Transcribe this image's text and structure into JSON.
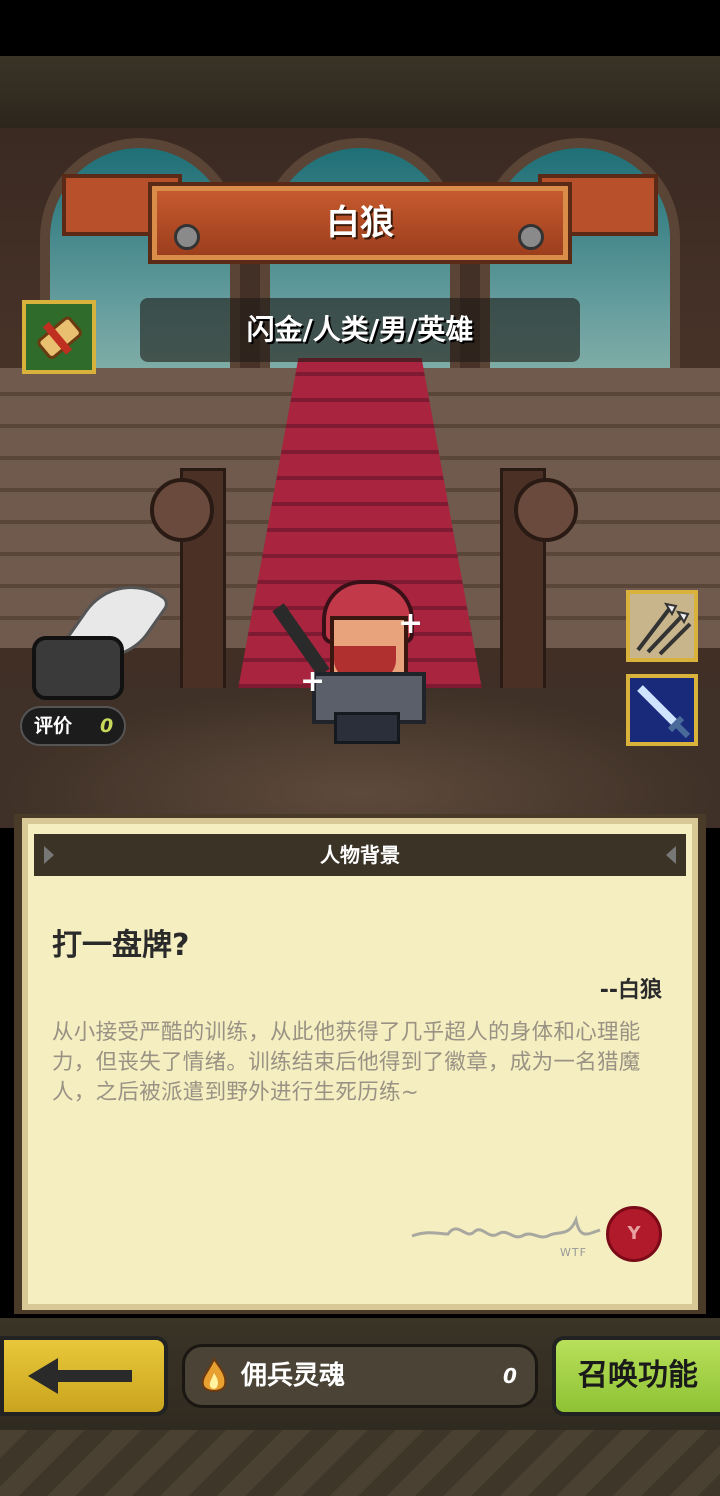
{
  "hero": {
    "name": "白狼",
    "subtitle": "闪金/人类/男/英雄"
  },
  "rating": {
    "label": "评价",
    "value": "0"
  },
  "panel": {
    "title": "人物背景",
    "quote": "打一盘牌?",
    "quote_author": "--白狼",
    "backstory": "从小接受严酷的训练，从此他获得了几乎超人的身体和心理能力，但丧失了情绪。训练结束后他得到了徽章，成为一名猎魔人，之后被派遣到野外进行生死历练~",
    "signature_mark": "WTF"
  },
  "bottom": {
    "soul_label": "佣兵灵魂",
    "soul_count": "0",
    "summon_label": "召唤功能"
  },
  "icons": {
    "scroll": "scroll-icon",
    "inkwell": "inkwell-quill-icon",
    "skill1": "triple-arrow-skill-icon",
    "skill2": "sword-skill-icon",
    "soul": "flame-soul-icon",
    "back": "back-arrow-icon",
    "seal": "wax-seal-icon"
  },
  "colors": {
    "banner": "#b8502b",
    "parchment": "#f4eec0",
    "back_button": "#e8c83a",
    "summon_button": "#a6d24a",
    "skill_border": "#d8b23a"
  }
}
